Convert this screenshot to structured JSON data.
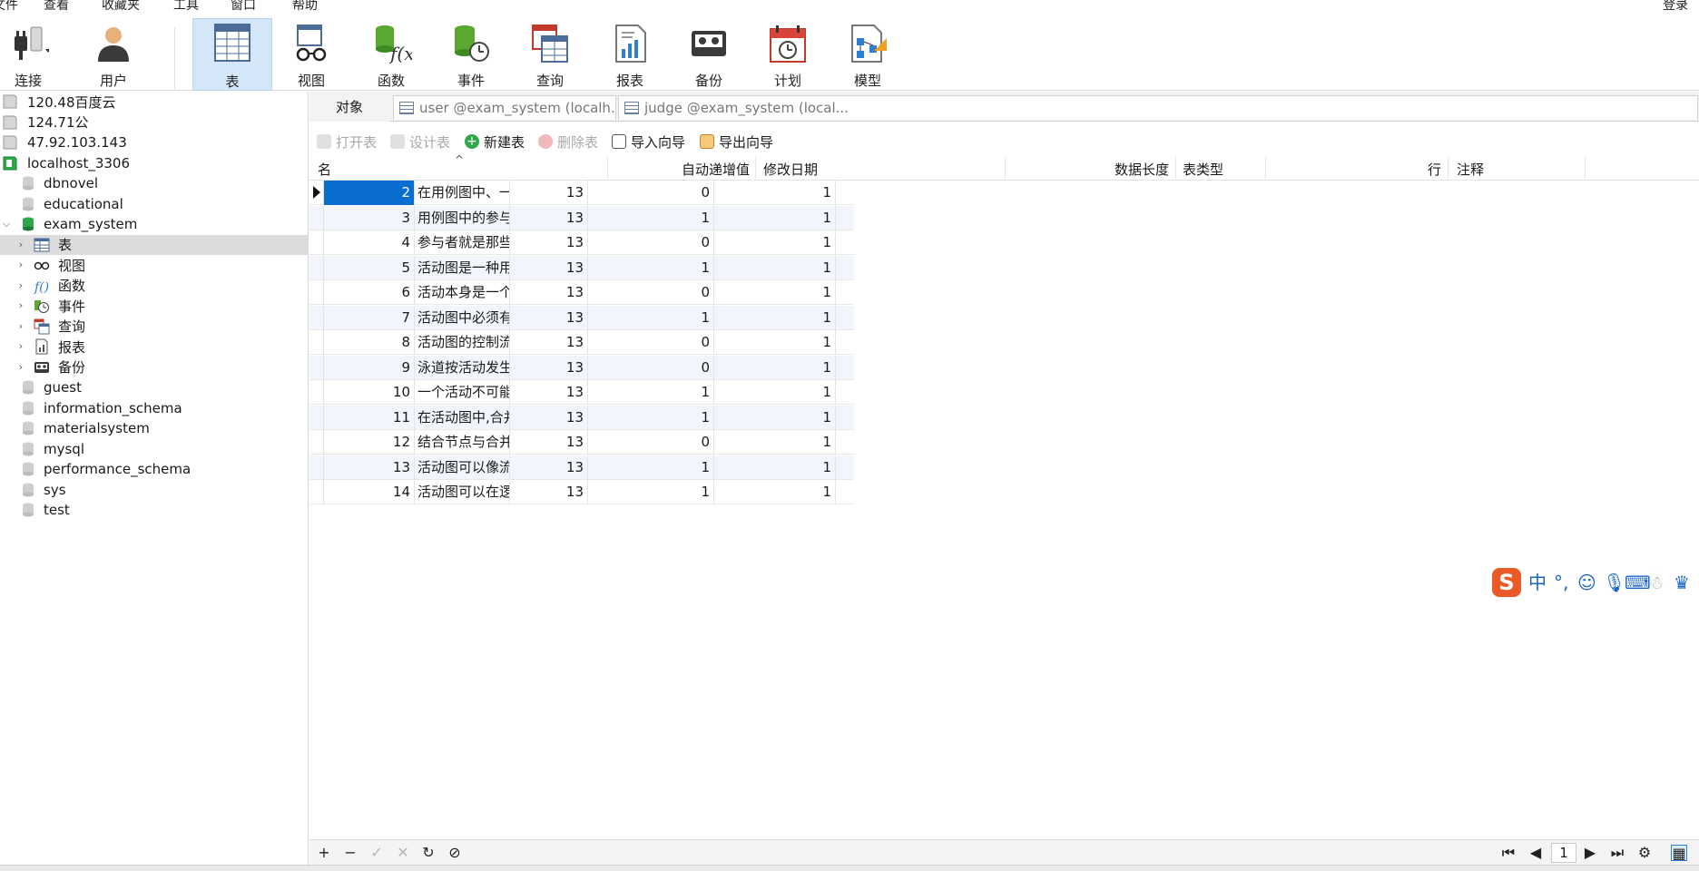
{
  "menu": {
    "items": [
      "文件",
      "查看",
      "收藏夹",
      "工具",
      "窗口",
      "帮助"
    ],
    "login": "登录"
  },
  "toolbar": {
    "connect": "连接",
    "user": "用户",
    "table": "表",
    "view": "视图",
    "function": "函数",
    "event": "事件",
    "query": "查询",
    "report": "报表",
    "backup": "备份",
    "schedule": "计划",
    "model": "模型"
  },
  "sidebar": {
    "connections": [
      "120.48百度云",
      "124.71公",
      "47.92.103.143",
      "localhost_3306"
    ],
    "db_above": [
      "dbnovel",
      "educational"
    ],
    "active_db": "exam_system",
    "sub_items": [
      "表",
      "视图",
      "函数",
      "事件",
      "查询",
      "报表",
      "备份"
    ],
    "db_below": [
      "guest",
      "information_schema",
      "materialsystem",
      "mysql",
      "performance_schema",
      "sys",
      "test"
    ]
  },
  "tabs": {
    "object": "对象",
    "tab1": "user @exam_system (localh...",
    "tab2": "judge @exam_system (local..."
  },
  "actions": {
    "open": "打开表",
    "design": "设计表",
    "new": "新建表",
    "delete": "删除表",
    "import": "导入向导",
    "export": "导出向导"
  },
  "grid": {
    "columns": {
      "name": "名",
      "auto_inc": "自动递增值",
      "modified": "修改日期",
      "data_len": "数据长度",
      "table_type": "表类型",
      "rows": "行",
      "comment": "注释"
    },
    "rows": [
      {
        "id": "2",
        "text": "在用例图中、一个",
        "c13": "13",
        "flag": "0",
        "one": "1"
      },
      {
        "id": "3",
        "text": "用例图中的参与者",
        "c13": "13",
        "flag": "1",
        "one": "1"
      },
      {
        "id": "4",
        "text": "参与者就是那些为",
        "c13": "13",
        "flag": "0",
        "one": "1"
      },
      {
        "id": "5",
        "text": "活动图是一种用于",
        "c13": "13",
        "flag": "1",
        "one": "1"
      },
      {
        "id": "6",
        "text": "活动本身是一个原",
        "c13": "13",
        "flag": "0",
        "one": "1"
      },
      {
        "id": "7",
        "text": "活动图中必须有且",
        "c13": "13",
        "flag": "1",
        "one": "1"
      },
      {
        "id": "8",
        "text": "活动图的控制流与",
        "c13": "13",
        "flag": "0",
        "one": "1"
      },
      {
        "id": "9",
        "text": "泳道按活动发生的",
        "c13": "13",
        "flag": "0",
        "one": "1"
      },
      {
        "id": "10",
        "text": "一个活动不可能属",
        "c13": "13",
        "flag": "1",
        "one": "1"
      },
      {
        "id": "11",
        "text": "在活动图中,合并节",
        "c13": "13",
        "flag": "1",
        "one": "1"
      },
      {
        "id": "12",
        "text": "结合节点与合并节",
        "c13": "13",
        "flag": "0",
        "one": "1"
      },
      {
        "id": "13",
        "text": "活动图可以像流程",
        "c13": "13",
        "flag": "1",
        "one": "1"
      },
      {
        "id": "14",
        "text": "活动图可以在逻辑",
        "c13": "13",
        "flag": "1",
        "one": "1"
      }
    ]
  },
  "pager": {
    "page": "1"
  },
  "ime": {
    "lang": "中"
  },
  "colors": {
    "selection": "#0a6ed1",
    "active_tool": "#d3e7f8",
    "db_green": "#2ea84a"
  }
}
